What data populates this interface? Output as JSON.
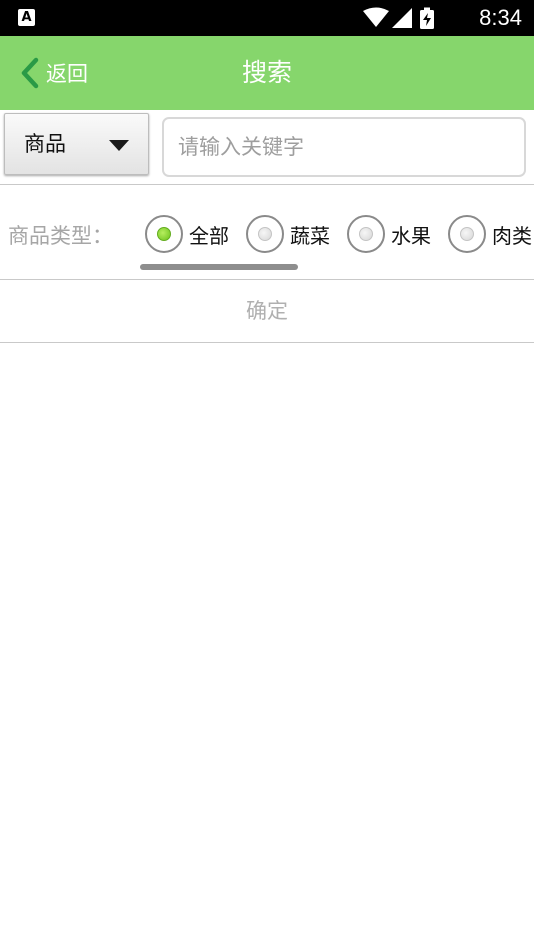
{
  "status_bar": {
    "left_icon_glyph": "A",
    "icons": [
      "wifi-icon",
      "cellular-signal-icon",
      "battery-charging-icon"
    ],
    "time": "8:34"
  },
  "title_bar": {
    "back_label": "返回",
    "title": "搜索",
    "background_color": "#86d66c"
  },
  "search": {
    "category_selected": "商品",
    "placeholder": "请输入关键字",
    "value": ""
  },
  "filter": {
    "label": "商品类型：",
    "options": [
      {
        "label": "全部",
        "checked": true
      },
      {
        "label": "蔬菜",
        "checked": false
      },
      {
        "label": "水果",
        "checked": false
      },
      {
        "label": "肉类",
        "checked": false
      }
    ],
    "accent_color": "#7ccf2a"
  },
  "confirm_label": "确定"
}
